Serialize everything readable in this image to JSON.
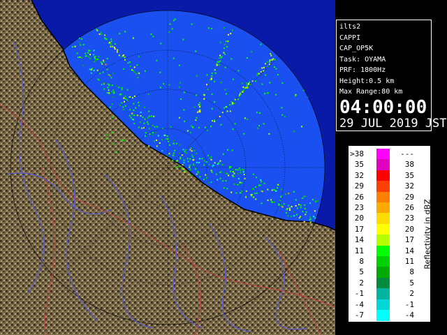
{
  "info": {
    "station": "ilts2",
    "product": "CAPPI",
    "scan": "CAP_OP5K",
    "task": "Task: OYAMA",
    "prf": "PRF: 1800Hz",
    "height": "Height:0.5 km",
    "max_range": "Max Range:80 km",
    "time": "04:00:00",
    "date": "29 JUL 2019 JST"
  },
  "legend": {
    "title": "Reflectivity in dBZ",
    "rows": [
      {
        "lo": ">38",
        "hi": "---",
        "color": "#ff00ff"
      },
      {
        "lo": "35",
        "hi": "38",
        "color": "#e000c0"
      },
      {
        "lo": "32",
        "hi": "35",
        "color": "#ff0000"
      },
      {
        "lo": "29",
        "hi": "32",
        "color": "#ff3f00"
      },
      {
        "lo": "26",
        "hi": "29",
        "color": "#ff7f00"
      },
      {
        "lo": "23",
        "hi": "26",
        "color": "#ffaa00"
      },
      {
        "lo": "20",
        "hi": "23",
        "color": "#ffdd00"
      },
      {
        "lo": "17",
        "hi": "20",
        "color": "#ffff00"
      },
      {
        "lo": "14",
        "hi": "17",
        "color": "#b4ff00"
      },
      {
        "lo": "11",
        "hi": "14",
        "color": "#00ff00"
      },
      {
        "lo": "8",
        "hi": "11",
        "color": "#00d200"
      },
      {
        "lo": "5",
        "hi": "8",
        "color": "#00aa00"
      },
      {
        "lo": "2",
        "hi": "5",
        "color": "#008c3c"
      },
      {
        "lo": "-1",
        "hi": "2",
        "color": "#00b4a0"
      },
      {
        "lo": "-4",
        "hi": "-1",
        "color": "#00d8d8"
      },
      {
        "lo": "-7",
        "hi": "-4",
        "color": "#00ffff"
      }
    ]
  },
  "map": {
    "colors": {
      "sea_background": "#0a1aa8",
      "radar_coverage": "#1a50f0",
      "land": "#7a6a48",
      "land_dark": "#3a3020",
      "rivers": "#5a5ad0",
      "borders": "#c04040",
      "coastline": "#000000"
    }
  }
}
